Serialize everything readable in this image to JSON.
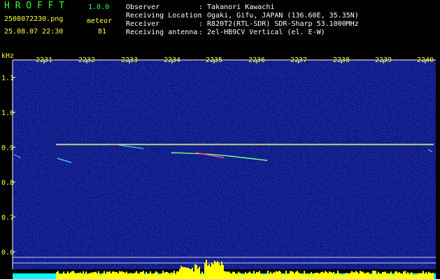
{
  "app": {
    "logo": "H R O F F T",
    "version": "1.0.0",
    "filename": "2508072230.png",
    "datetime": "25.08.07 22:30",
    "mode": "meteor",
    "count": "81"
  },
  "info": {
    "labels": [
      "Observer",
      "Receiving Location",
      "Receiver",
      "Receiving antenna"
    ],
    "values": [
      ": Takanori Kawachi",
      ": Ogaki, Gifu, JAPAN (136.60E, 35.35N)",
      ": R820T2(RTL-SDR) SDR-Sharp 53.1000MHz",
      ": 2el-HB9CV Vertical (el. E-W)"
    ]
  },
  "chart_data": {
    "type": "heatmap",
    "y_unit_label": "kHz",
    "x_ticks": [
      "2231",
      "2232",
      "2233",
      "2234",
      "2235",
      "2236",
      "2237",
      "2238",
      "2239",
      "2240"
    ],
    "y_ticks": [
      "1.1",
      "1.0",
      "0.9",
      "0.8",
      "0.7",
      "0.6"
    ],
    "ylim": [
      0.6,
      1.1
    ],
    "carrier_khz": 0.91,
    "colors": {
      "background": "#0a1580",
      "noise": "#3040e0",
      "carrier": "#ffe060",
      "axis": "#ffffff",
      "tick_label": "#ffff33",
      "signal_bar": "#ffff00",
      "baseline_bar": "#00ffff"
    }
  }
}
